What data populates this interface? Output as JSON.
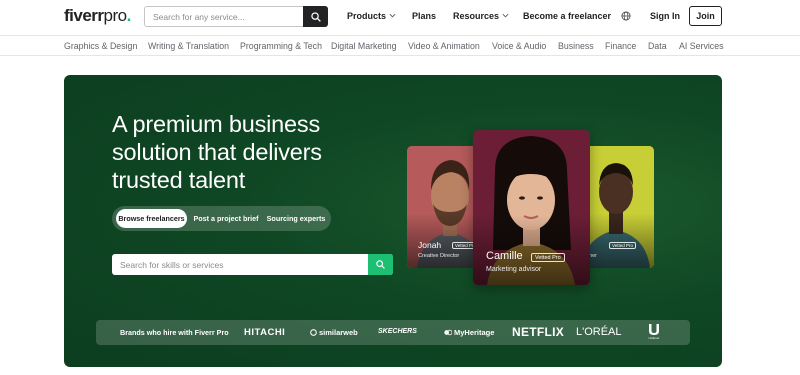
{
  "header": {
    "logo_main": "fiverr",
    "logo_suffix": "pro",
    "logo_dot": ".",
    "search_placeholder": "Search for any service...",
    "nav": {
      "products": "Products",
      "plans": "Plans",
      "resources": "Resources",
      "become_freelancer": "Become a freelancer",
      "sign_in": "Sign In",
      "join": "Join"
    }
  },
  "categories": [
    "Graphics & Design",
    "Writing & Translation",
    "Programming & Tech",
    "Digital Marketing",
    "Video & Animation",
    "Voice & Audio",
    "Business",
    "Finance",
    "Data",
    "AI Services"
  ],
  "hero": {
    "headline": "A premium business solution that delivers trusted talent",
    "tabs": [
      "Browse freelancers",
      "Post a project brief",
      "Sourcing experts"
    ],
    "active_tab": "Browse freelancers",
    "search_placeholder": "Search for skills or services"
  },
  "talent_cards": [
    {
      "name": "Jonah",
      "role": "Creative Director",
      "badge": "Vetted Pro"
    },
    {
      "name": "Camille",
      "role": "Marketing advisor",
      "badge": "Vetted Pro"
    },
    {
      "name": "s",
      "role": "grapher",
      "badge": "Vetted Pro"
    }
  ],
  "brands": {
    "label": "Brands who hire with Fiverr Pro",
    "logos": [
      "HITACHI",
      "similarweb",
      "SKECHERS",
      "MyHeritage",
      "NETFLIX",
      "L'ORÉAL",
      "Unilever"
    ]
  },
  "colors": {
    "brand_green": "#1dbf73",
    "hero_green": "#0f4724",
    "dark": "#222325"
  },
  "icons": {
    "search": "search-icon",
    "chevron": "chevron-down-icon",
    "globe": "globe-icon"
  }
}
